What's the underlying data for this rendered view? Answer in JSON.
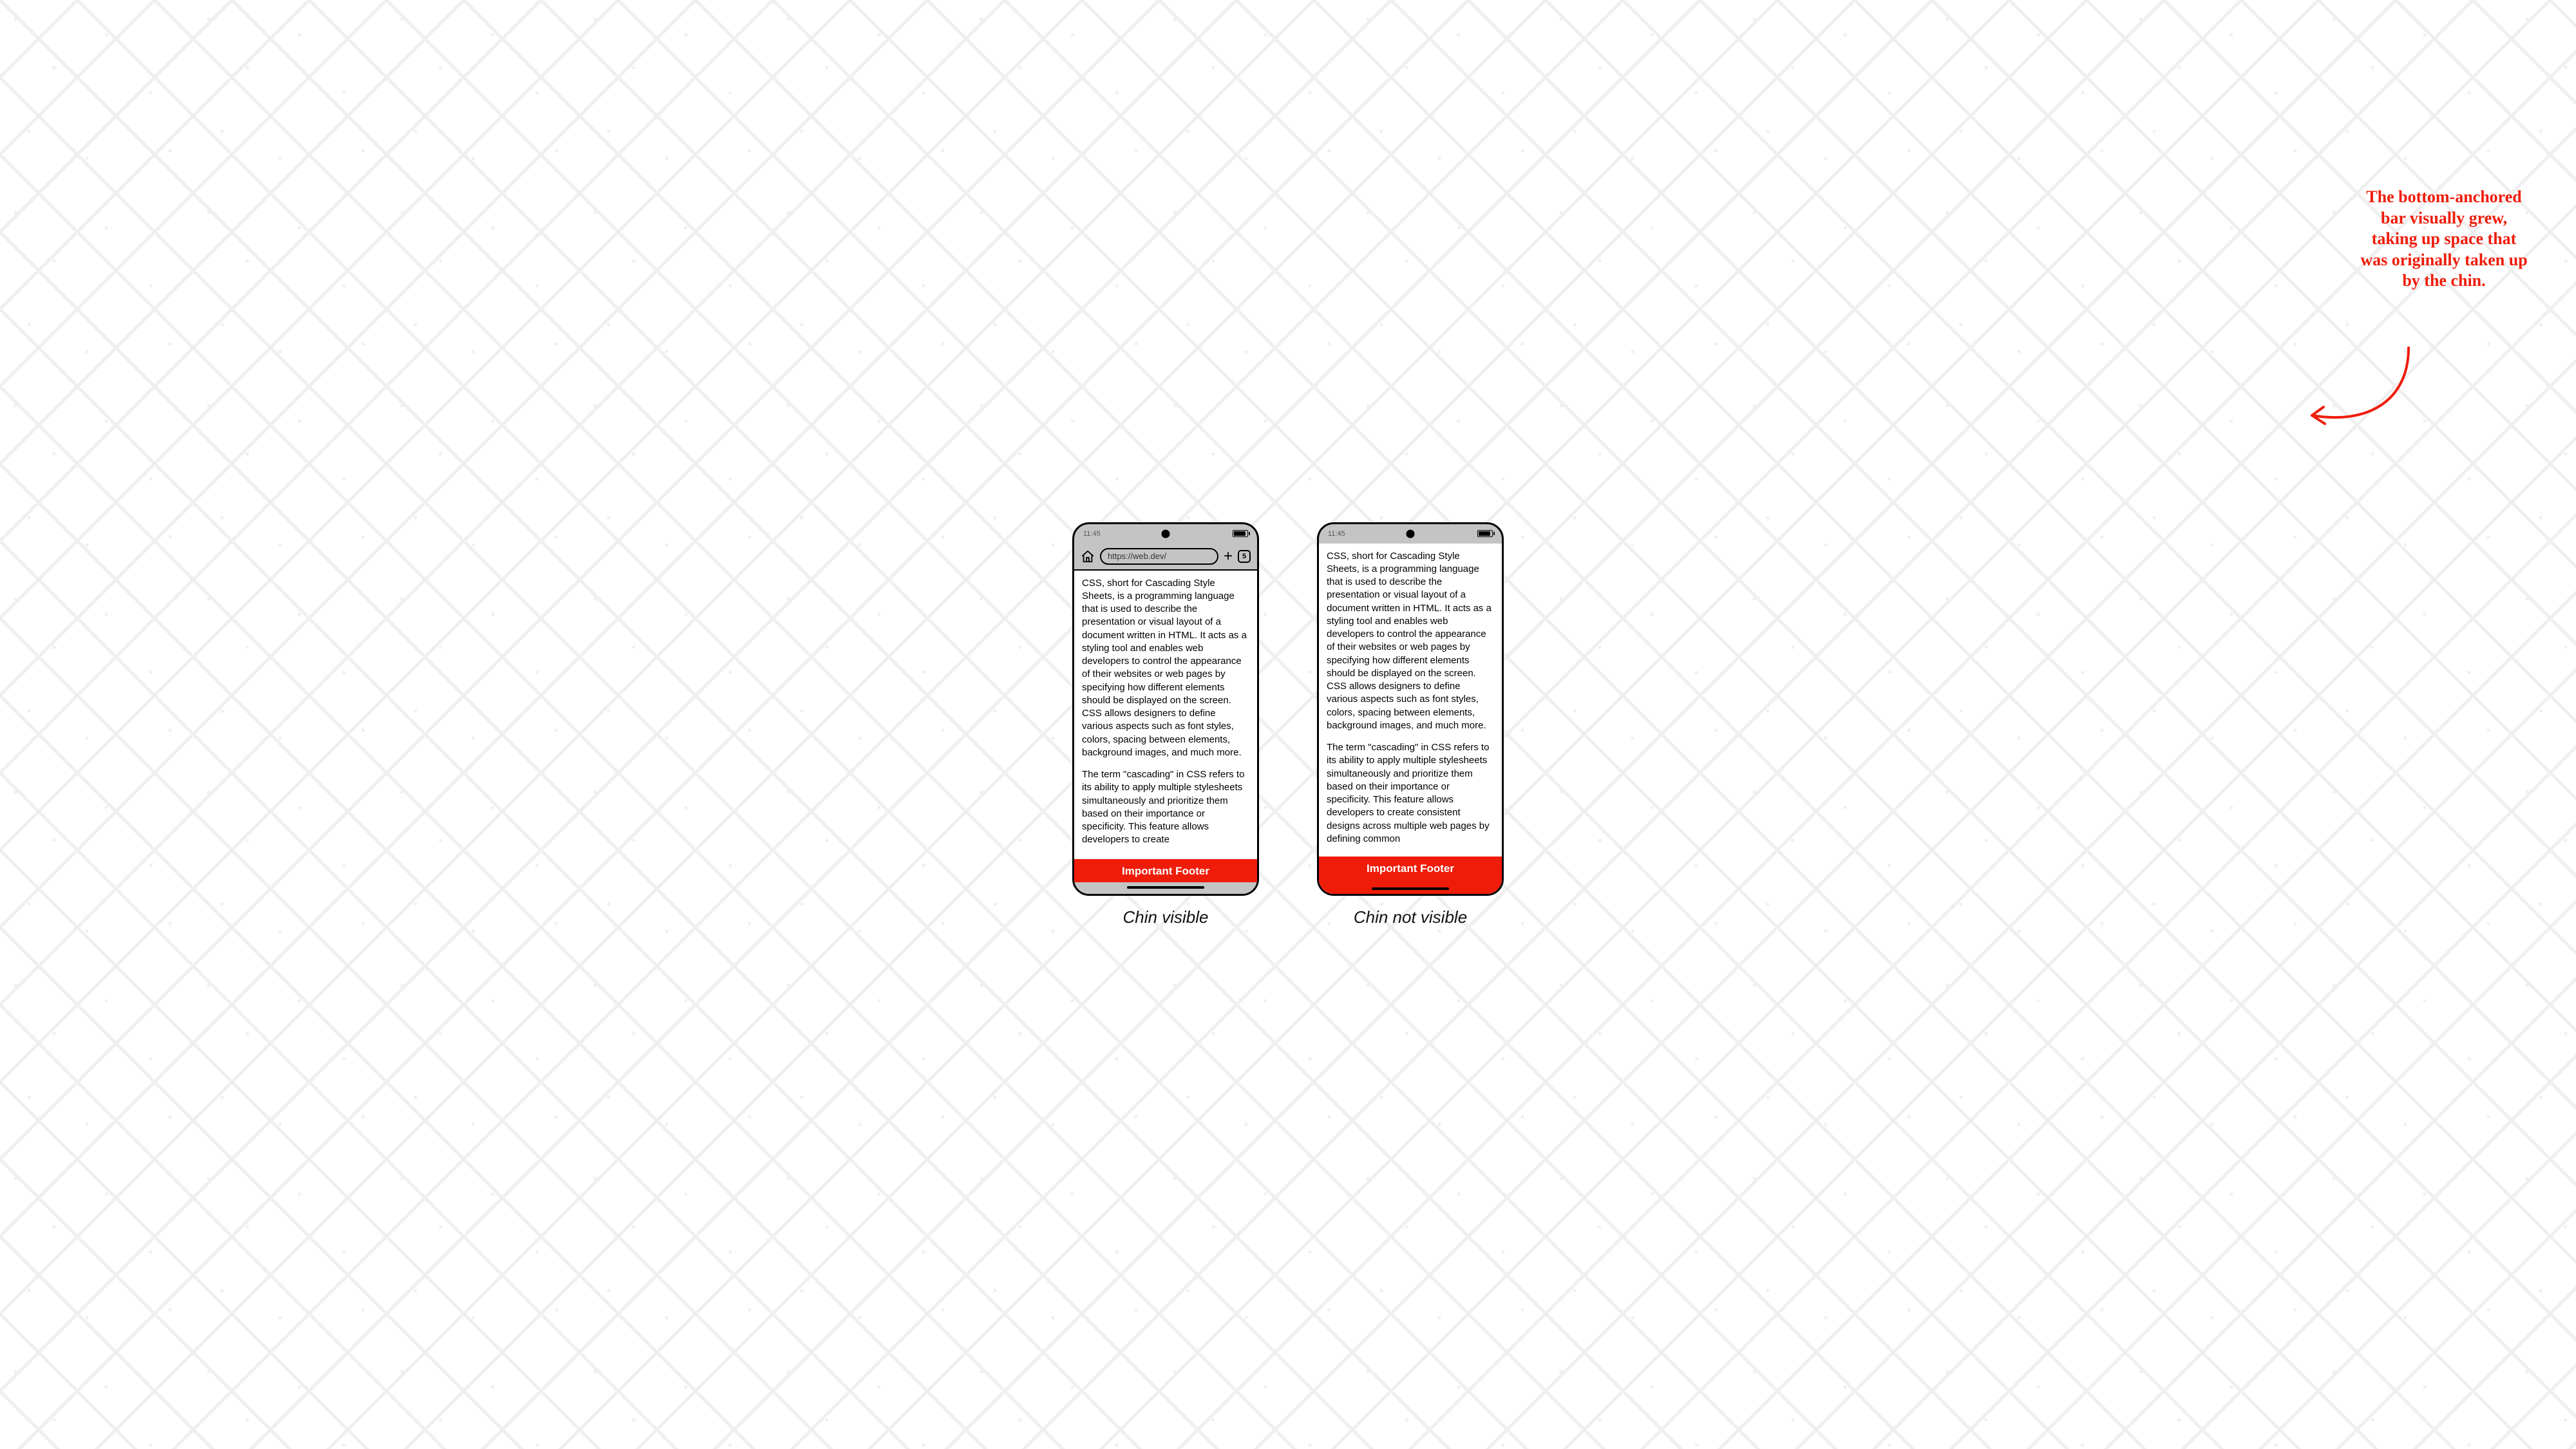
{
  "status": {
    "time": "11:45"
  },
  "browser": {
    "url": "https://web.dev/",
    "tab_count": "5"
  },
  "content": {
    "p1": "CSS, short for Cascading Style Sheets, is a programming language that is used to describe the presentation or visual layout of a document written in HTML. It acts as a styling tool and enables web developers to control the appearance of their websites or web pages by specifying how different elements should be displayed on the screen. CSS allows designers to define various aspects such as font styles, colors, spacing between elements, background images, and much more.",
    "p2_short": "The term \"cascading\" in CSS refers to its ability to apply multiple stylesheets simultaneously and prioritize them based on their importance or specificity. This feature allows developers to create",
    "p2_long": "The term \"cascading\" in CSS refers to its ability to apply multiple stylesheets simultaneously and prioritize them based on their importance or specificity. This feature allows developers to create consistent designs across multiple web pages by defining common"
  },
  "footer": {
    "label": "Important Footer"
  },
  "captions": {
    "left": "Chin visible",
    "right": "Chin not visible"
  },
  "annotation": {
    "text": "The bottom-anchored bar visually grew, taking up space that was originally taken up by the chin."
  },
  "colors": {
    "footer_bg": "#ef1c0a",
    "annotation": "#ef1c0a"
  }
}
